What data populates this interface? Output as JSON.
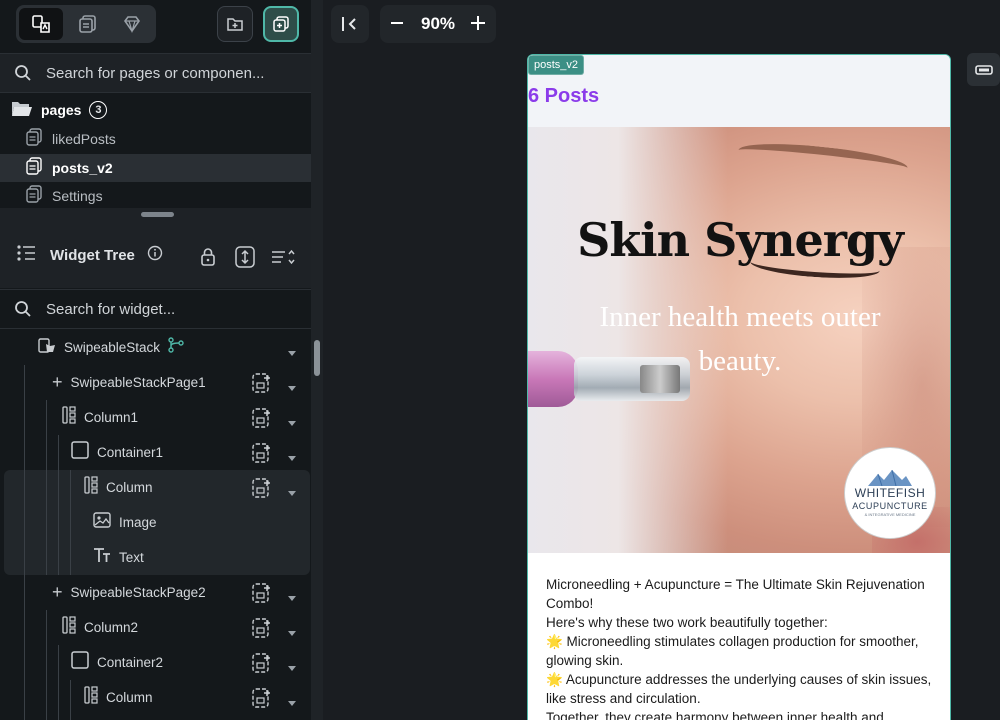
{
  "left_panel": {
    "search_pages_placeholder": "Search for pages or componen...",
    "pages_label": "pages",
    "pages_count": "3",
    "pages": [
      {
        "label": "likedPosts"
      },
      {
        "label": "posts_v2"
      },
      {
        "label": "Settings"
      }
    ],
    "widget_tree_label": "Widget Tree",
    "search_widget_placeholder": "Search for widget...",
    "tree": [
      {
        "label": "SwipeableStack"
      },
      {
        "label": "SwipeableStackPage1"
      },
      {
        "label": "Column1"
      },
      {
        "label": "Container1"
      },
      {
        "label": "Column"
      },
      {
        "label": "Image"
      },
      {
        "label": "Text"
      },
      {
        "label": "SwipeableStackPage2"
      },
      {
        "label": "Column2"
      },
      {
        "label": "Container2"
      },
      {
        "label": "Column"
      }
    ]
  },
  "canvas": {
    "zoom": "90%",
    "page_tag": "posts_v2",
    "posts_count": "6 Posts",
    "hero_title": "Skin Synergy",
    "hero_subtitle": "Inner health meets outer beauty.",
    "logo_name": "WHITEFISH",
    "logo_sub": "ACUPUNCTURE",
    "logo_tagline": "& INTEGRATIVE MEDICINE",
    "body_lines": [
      "Microneedling + Acupuncture = The Ultimate Skin Rejuvenation Combo!",
      "Here's why these two work beautifully together:",
      "🌟 Microneedling stimulates collagen production for smoother, glowing skin.",
      "🌟 Acupuncture addresses the underlying causes of skin issues, like stress and circulation.",
      "Together, they create harmony between inner health and"
    ]
  },
  "colors": {
    "accent_teal": "#4fb8a8",
    "posts_purple": "#8b3bea",
    "panel_bg": "#14181b"
  }
}
